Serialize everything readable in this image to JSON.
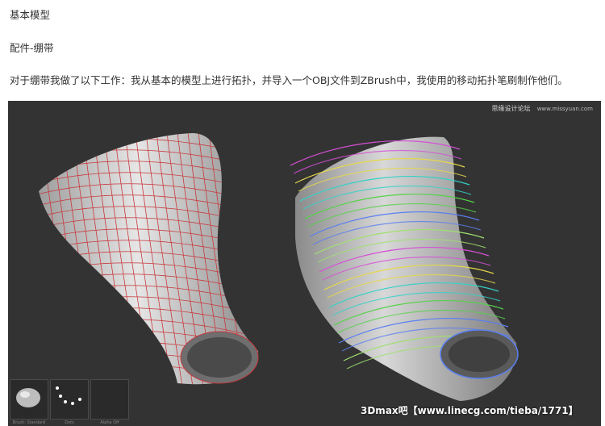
{
  "article": {
    "heading1": "基本模型",
    "heading2": "配件-绷带",
    "paragraph": "对于绷带我做了以下工作：我从基本的模型上进行拓扑，并导入一个OBJ文件到ZBrush中，我使用的移动拓扑笔刷制作他们。"
  },
  "viewport": {
    "watermark_site": "思缘设计论坛",
    "watermark_url": "www.missyuan.com",
    "caption": "3Dmax吧【www.linecg.com/tieba/1771】",
    "tray": [
      {
        "label": "Brush: Standard",
        "icon": "clay-brush-icon"
      },
      {
        "label": "Dots",
        "icon": "stroke-dots-icon"
      },
      {
        "label": "Alpha Off",
        "icon": "alpha-off-icon"
      }
    ],
    "band_colors": [
      "#d64fd6",
      "#e6d84a",
      "#35d1c8",
      "#56d24a",
      "#5a7ff0",
      "#a0e070"
    ],
    "mesh_wire_color": "#c8383d",
    "background_color": "#333333"
  }
}
